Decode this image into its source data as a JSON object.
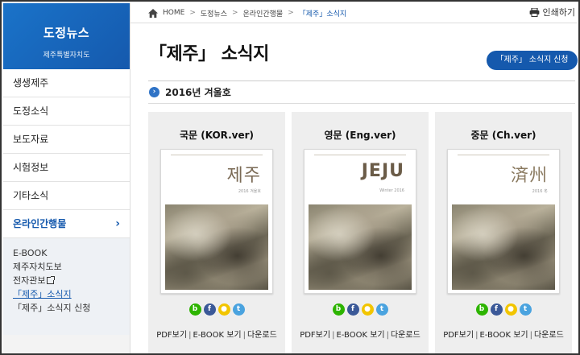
{
  "sidebar": {
    "title": "도정뉴스",
    "subtitle": "제주특별자치도",
    "items": [
      {
        "label": "생생제주"
      },
      {
        "label": "도정소식"
      },
      {
        "label": "보도자료"
      },
      {
        "label": "시험정보"
      },
      {
        "label": "기타소식"
      },
      {
        "label": "온라인간행물",
        "active": true,
        "chevron": "›"
      }
    ],
    "subitems": [
      {
        "label": "E-BOOK"
      },
      {
        "label": "제주자치도보"
      },
      {
        "label": "전자관보"
      },
      {
        "label": "「제주」소식지",
        "current": true
      },
      {
        "label": "「제주」소식지 신청"
      }
    ]
  },
  "breadcrumb": {
    "home": "HOME",
    "sep": ">",
    "items": [
      "도정뉴스",
      "온라인간행물",
      "「제주」소식지"
    ]
  },
  "print_label": "인쇄하기",
  "page_title": "「제주」 소식지",
  "apply_button": "「제주」 소식지 신청",
  "issue": {
    "label": "2016년 겨울호",
    "icon": "›"
  },
  "cards": [
    {
      "name": "국문 (KOR.ver)",
      "cover_title": "제주",
      "cover_small": "2016 겨울호",
      "share": [
        "b",
        "f",
        "●",
        "t"
      ],
      "links": {
        "pdf": "PDF보기",
        "ebook": "E-BOOK 보기",
        "download": "다운로드"
      }
    },
    {
      "name": "영문 (Eng.ver)",
      "cover_title": "JEJU",
      "cover_small": "Winter 2016",
      "share": [
        "b",
        "f",
        "●",
        "t"
      ],
      "links": {
        "pdf": "PDF보기",
        "ebook": "E-BOOK 보기",
        "download": "다운로드"
      }
    },
    {
      "name": "중문 (Ch.ver)",
      "cover_title": "済州",
      "cover_small": "2016 冬",
      "share": [
        "b",
        "f",
        "●",
        "t"
      ],
      "links": {
        "pdf": "PDF보기",
        "ebook": "E-BOOK 보기",
        "download": "다운로드"
      }
    }
  ],
  "link_separator": "|",
  "colors": {
    "brand": "#1559ad",
    "accent": "#2f73c6",
    "card_bg": "#eeeeee"
  }
}
